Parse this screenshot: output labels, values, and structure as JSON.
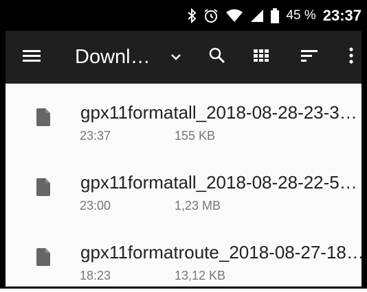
{
  "status_bar": {
    "icons": [
      "bluetooth-icon",
      "alarm-icon",
      "wifi-icon",
      "signal-icon",
      "battery-icon"
    ],
    "battery_percent": "45 %",
    "clock": "23:37"
  },
  "toolbar": {
    "icons": [
      "menu-icon",
      "chevron-down-icon",
      "search-icon",
      "grid-view-icon",
      "sort-icon",
      "more-vert-icon"
    ],
    "title": "Downl…"
  },
  "files": [
    {
      "name": "gpx11formatall_2018-08-28-23-3…",
      "time": "23:37",
      "size": "155 KB",
      "icon": "file-icon"
    },
    {
      "name": "gpx11formatall_2018-08-28-22-5…",
      "time": "23:00",
      "size": "1,23 MB",
      "icon": "file-icon"
    },
    {
      "name": "gpx11formatroute_2018-08-27-18…",
      "time": "18:23",
      "size": "13,12 KB",
      "icon": "file-icon"
    }
  ],
  "colors": {
    "toolbar_bg": "#1f1f1f",
    "status_bg": "#000000",
    "list_bg": "#fafafa",
    "file_icon": "#666666"
  }
}
